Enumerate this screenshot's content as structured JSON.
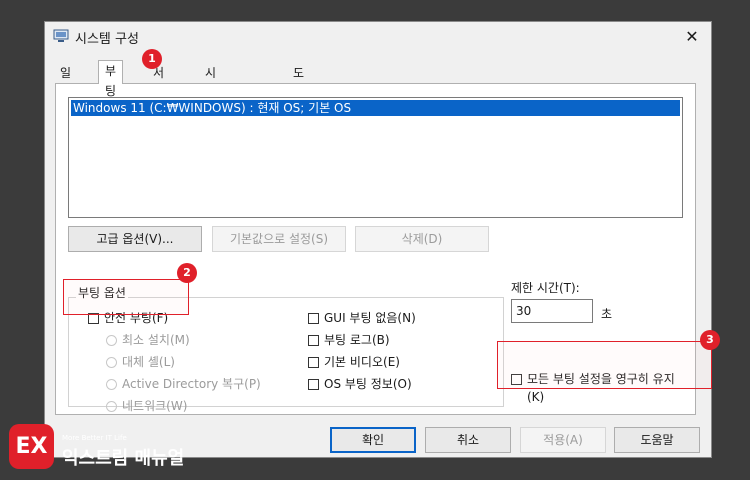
{
  "window": {
    "title": "시스템 구성",
    "close_icon": "close-icon",
    "app_icon": "system-config-icon"
  },
  "tabs": [
    {
      "label": "일반"
    },
    {
      "label": "부팅"
    },
    {
      "label": "서비스"
    },
    {
      "label": "시작프로그램"
    },
    {
      "label": "도구"
    }
  ],
  "os_list": {
    "items": [
      "Windows 11 (C:₩WINDOWS) : 현재 OS; 기본 OS"
    ]
  },
  "list_buttons": {
    "advanced": "고급 옵션(V)...",
    "set_default": "기본값으로 설정(S)",
    "delete": "삭제(D)"
  },
  "boot_options": {
    "title": "부팅 옵션",
    "safe_boot": "안전 부팅(F)",
    "radios": [
      "최소 설치(M)",
      "대체 셸(L)",
      "Active Directory 복구(P)",
      "네트워크(W)"
    ],
    "right_checks": [
      "GUI 부팅 없음(N)",
      "부팅 로그(B)",
      "기본 비디오(E)",
      "OS 부팅 정보(O)"
    ]
  },
  "timeout": {
    "label": "제한 시간(T):",
    "value": "30",
    "unit": "초"
  },
  "persist": {
    "label_line1": "모든 부팅 설정을 영구히 유지",
    "label_line2": "(K)"
  },
  "footer": {
    "ok": "확인",
    "cancel": "취소",
    "apply": "적용(A)",
    "help": "도움말"
  },
  "annotations": {
    "badge1": "1",
    "badge2": "2",
    "badge3": "3",
    "color": "#e0202a"
  },
  "logo": {
    "mark": "EX",
    "tagline": "More Better IT Life",
    "name": "익스트림 매뉴얼"
  }
}
